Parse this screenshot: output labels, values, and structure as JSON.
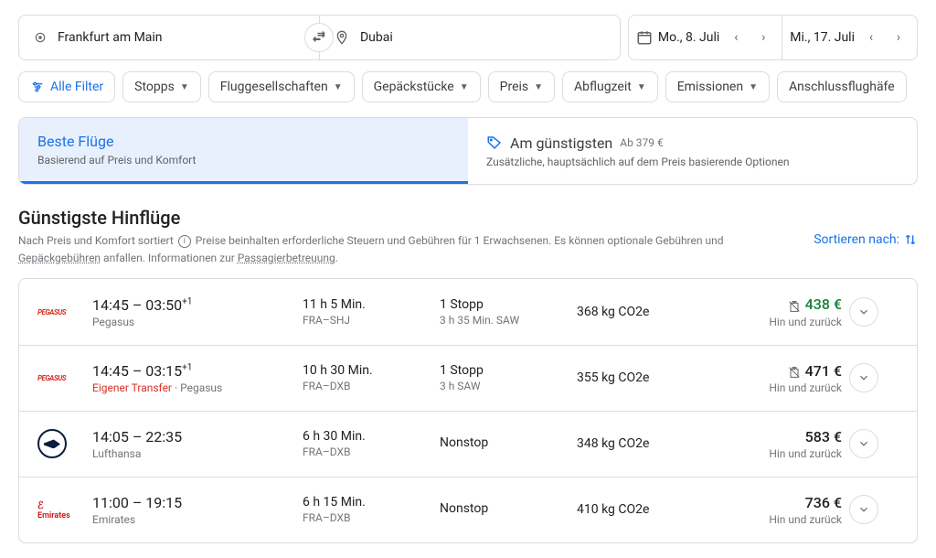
{
  "search": {
    "origin": "Frankfurt am Main",
    "destination": "Dubai",
    "depart_date": "Mo., 8. Juli",
    "return_date": "Mi., 17. Juli"
  },
  "filters": {
    "all": "Alle Filter",
    "stops": "Stopps",
    "airlines": "Fluggesellschaften",
    "bags": "Gepäckstücke",
    "price": "Preis",
    "time": "Abflugzeit",
    "emissions": "Emissionen",
    "connecting": "Anschlussflughäfe"
  },
  "tabs": {
    "best": {
      "title": "Beste Flüge",
      "sub": "Basierend auf Preis und Komfort"
    },
    "cheap": {
      "title": "Am günstigsten",
      "from": "Ab 379 €",
      "sub": "Zusätzliche, hauptsächlich auf dem Preis basierende Optionen"
    }
  },
  "section": {
    "title": "Günstigste Hinflüge",
    "sub_a": "Nach Preis und Komfort sortiert",
    "sub_b": "Preise beinhalten erforderliche Steuern und Gebühren für 1 Erwachsenen. Es können optionale Gebühren und ",
    "sub_link1": "Gepäckgebühren",
    "sub_c": " anfallen. Informationen zur ",
    "sub_link2": "Passagierbetreuung",
    "sub_d": ".",
    "sort": "Sortieren nach:"
  },
  "flights": [
    {
      "logo": "pegasus",
      "times": "14:45 – 03:50",
      "plus": "+1",
      "airline": "Pegasus",
      "transfer": "",
      "duration": "11 h 5 Min.",
      "route": "FRA–SHJ",
      "stops": "1 Stopp",
      "stops_sub": "3 h 35 Min. SAW",
      "emissions": "368 kg CO2e",
      "price": "438 €",
      "price_green": true,
      "bag_warn": true,
      "trip": "Hin und zurück"
    },
    {
      "logo": "pegasus",
      "times": "14:45 – 03:15",
      "plus": "+1",
      "airline": "Pegasus",
      "transfer": "Eigener Transfer",
      "duration": "10 h 30 Min.",
      "route": "FRA–DXB",
      "stops": "1 Stopp",
      "stops_sub": "3 h SAW",
      "emissions": "355 kg CO2e",
      "price": "471 €",
      "price_green": false,
      "bag_warn": true,
      "trip": "Hin und zurück"
    },
    {
      "logo": "lufthansa",
      "times": "14:05 – 22:35",
      "plus": "",
      "airline": "Lufthansa",
      "transfer": "",
      "duration": "6 h 30 Min.",
      "route": "FRA–DXB",
      "stops": "Nonstop",
      "stops_sub": "",
      "emissions": "348 kg CO2e",
      "price": "583 €",
      "price_green": false,
      "bag_warn": false,
      "trip": "Hin und zurück"
    },
    {
      "logo": "emirates",
      "times": "11:00 – 19:15",
      "plus": "",
      "airline": "Emirates",
      "transfer": "",
      "duration": "6 h 15 Min.",
      "route": "FRA–DXB",
      "stops": "Nonstop",
      "stops_sub": "",
      "emissions": "410 kg CO2e",
      "price": "736 €",
      "price_green": false,
      "bag_warn": false,
      "trip": "Hin und zurück"
    }
  ]
}
